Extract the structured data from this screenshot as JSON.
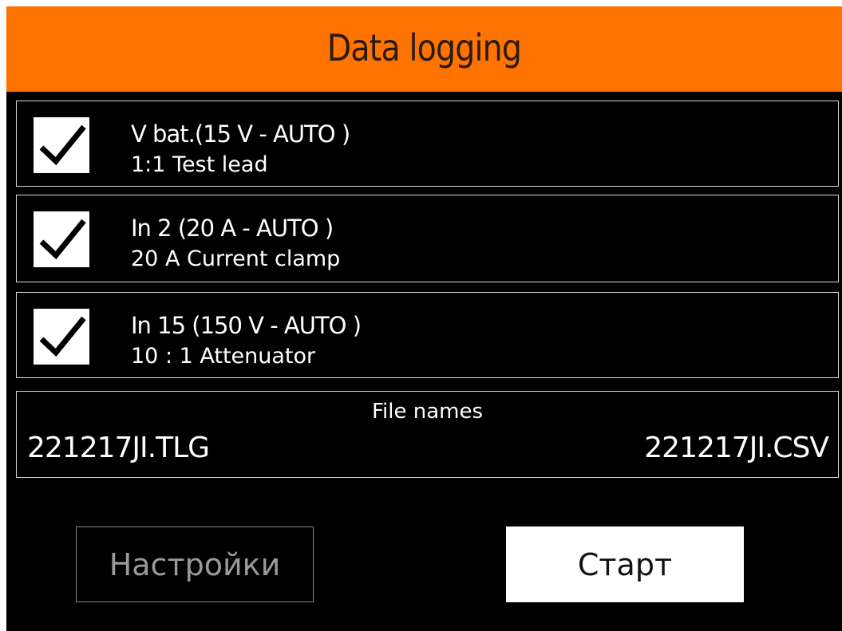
{
  "header": {
    "title": "Data logging"
  },
  "channels": [
    {
      "checked": true,
      "line1": "V bat.(15 V - AUTO )",
      "line2": "1:1 Test lead"
    },
    {
      "checked": true,
      "line1": "In 2 (20 A - AUTO )",
      "line2": "20 A Current clamp"
    },
    {
      "checked": true,
      "line1": "In 15 (150 V - AUTO )",
      "line2": "10 : 1 Attenuator"
    }
  ],
  "files": {
    "title": "File names",
    "left": "221217JI.TLG",
    "right": "221217JI.CSV"
  },
  "buttons": {
    "settings_label": "Настройки",
    "start_label": "Старт"
  },
  "colors": {
    "header": "#ff7300",
    "background": "#000000",
    "text": "#ffffff",
    "border": "#d8d8d8",
    "disabled_text": "#9a9a9a"
  },
  "icons": {
    "check": "check-icon"
  }
}
